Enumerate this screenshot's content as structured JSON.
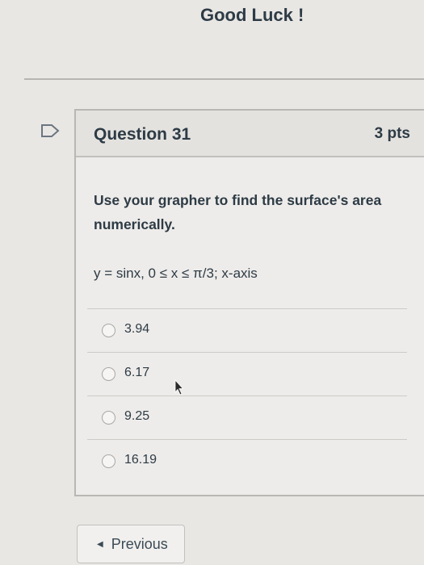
{
  "header": {
    "title": "Good Luck !"
  },
  "question": {
    "title": "Question 31",
    "points": "3 pts",
    "text": "Use your grapher to find the surface's area numerically.",
    "formula": "y = sinx, 0 ≤ x ≤ π/3; x-axis",
    "answers": [
      {
        "label": "3.94"
      },
      {
        "label": "6.17"
      },
      {
        "label": "9.25"
      },
      {
        "label": "16.19"
      }
    ]
  },
  "nav": {
    "previous_label": "Previous"
  }
}
